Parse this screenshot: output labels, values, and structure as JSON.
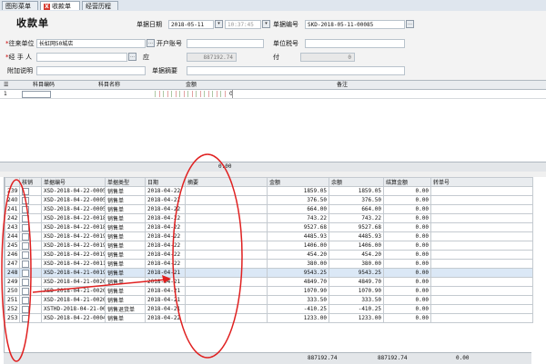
{
  "tabs": [
    {
      "label": "图形菜单"
    },
    {
      "label": "收款单",
      "close": "X"
    },
    {
      "label": "经营历程"
    }
  ],
  "form": {
    "title": "收款单",
    "doc_date_label": "单据日期",
    "doc_date_value": "2018-05-11",
    "doc_time_value": "10:37:45",
    "doc_no_label": "单据编号",
    "doc_no_value": "SKD-2018-05-11-00085",
    "counterparty_label": "往来单位",
    "counterparty_value": "长虹网50城店",
    "bank_account_label": "开户账号",
    "tax_no_label": "单位税号",
    "handler_label": "经 手 人",
    "due_label": "应",
    "due_value": "887192.74",
    "paid_label": "付",
    "paid_value": "0",
    "note_label": "附加说明",
    "summary_label": "单据摘要"
  },
  "entry_grid": {
    "headers": [
      "科目编码",
      "科目名称",
      "金额",
      "备注"
    ],
    "row_no": "1",
    "row_amount": "0",
    "total": "0.00"
  },
  "main_table": {
    "headers": [
      "核销",
      "单据编号",
      "单据类型",
      "日期",
      "摘要",
      "金额",
      "余额",
      "结算金额",
      "转单号"
    ],
    "rows": [
      {
        "no": "239",
        "doc": "XSD-2018-04-22-00050",
        "type": "销售单",
        "date": "2018-04-22",
        "amount": "1859.05",
        "balance": "1859.05",
        "settle": "0.00"
      },
      {
        "no": "240",
        "doc": "XSD-2018-04-22-00051",
        "type": "销售单",
        "date": "2018-04-22",
        "amount": "376.50",
        "balance": "376.50",
        "settle": "0.00"
      },
      {
        "no": "241",
        "doc": "XSD-2018-04-22-00052",
        "type": "销售单",
        "date": "2018-04-22",
        "amount": "664.00",
        "balance": "664.00",
        "settle": "0.00"
      },
      {
        "no": "242",
        "doc": "XSD-2018-04-22-00182",
        "type": "销售单",
        "date": "2018-04-22",
        "amount": "743.22",
        "balance": "743.22",
        "settle": "0.00"
      },
      {
        "no": "243",
        "doc": "XSD-2018-04-22-00186",
        "type": "销售单",
        "date": "2018-04-22",
        "amount": "9527.68",
        "balance": "9527.68",
        "settle": "0.00"
      },
      {
        "no": "244",
        "doc": "XSD-2018-04-22-00192",
        "type": "销售单",
        "date": "2018-04-22",
        "amount": "4485.93",
        "balance": "4485.93",
        "settle": "0.00"
      },
      {
        "no": "245",
        "doc": "XSD-2018-04-22-00193",
        "type": "销售单",
        "date": "2018-04-22",
        "amount": "1406.00",
        "balance": "1406.00",
        "settle": "0.00"
      },
      {
        "no": "246",
        "doc": "XSD-2018-04-22-00195",
        "type": "销售单",
        "date": "2018-04-22",
        "amount": "454.20",
        "balance": "454.20",
        "settle": "0.00"
      },
      {
        "no": "247",
        "doc": "XSD-2018-04-22-00117",
        "type": "销售单",
        "date": "2018-04-22",
        "amount": "380.00",
        "balance": "380.00",
        "settle": "0.00"
      },
      {
        "no": "248",
        "doc": "XSD-2018-04-21-00190",
        "type": "销售单",
        "date": "2018-04-21",
        "amount": "9543.25",
        "balance": "9543.25",
        "settle": "0.00"
      },
      {
        "no": "249",
        "doc": "XSD-2018-04-21-00203",
        "type": "销售单",
        "date": "2018-04-21",
        "amount": "4849.70",
        "balance": "4849.70",
        "settle": "0.00"
      },
      {
        "no": "250",
        "doc": "XSD-2018-04-21-00205",
        "type": "销售单",
        "date": "2018-04-21",
        "amount": "1070.90",
        "balance": "1070.90",
        "settle": "0.00"
      },
      {
        "no": "251",
        "doc": "XSD-2018-04-21-00206",
        "type": "销售单",
        "date": "2018-04-21",
        "amount": "333.50",
        "balance": "333.50",
        "settle": "0.00"
      },
      {
        "no": "252",
        "doc": "XSTHD-2018-04-21-00000",
        "type": "销售退货单",
        "date": "2018-04-21",
        "amount": "-410.25",
        "balance": "-410.25",
        "settle": "0.00"
      },
      {
        "no": "253",
        "doc": "XSD-2018-04-22-00049",
        "type": "销售单",
        "date": "2018-04-22",
        "amount": "1233.00",
        "balance": "1233.00",
        "settle": "0.00"
      }
    ],
    "total_amount": "887192.74",
    "total_balance": "887192.74",
    "total_settle": "0.00"
  },
  "colors": {
    "annotation": "#e02020",
    "required": "#cc0000",
    "header_bg": "#e9ecef"
  }
}
